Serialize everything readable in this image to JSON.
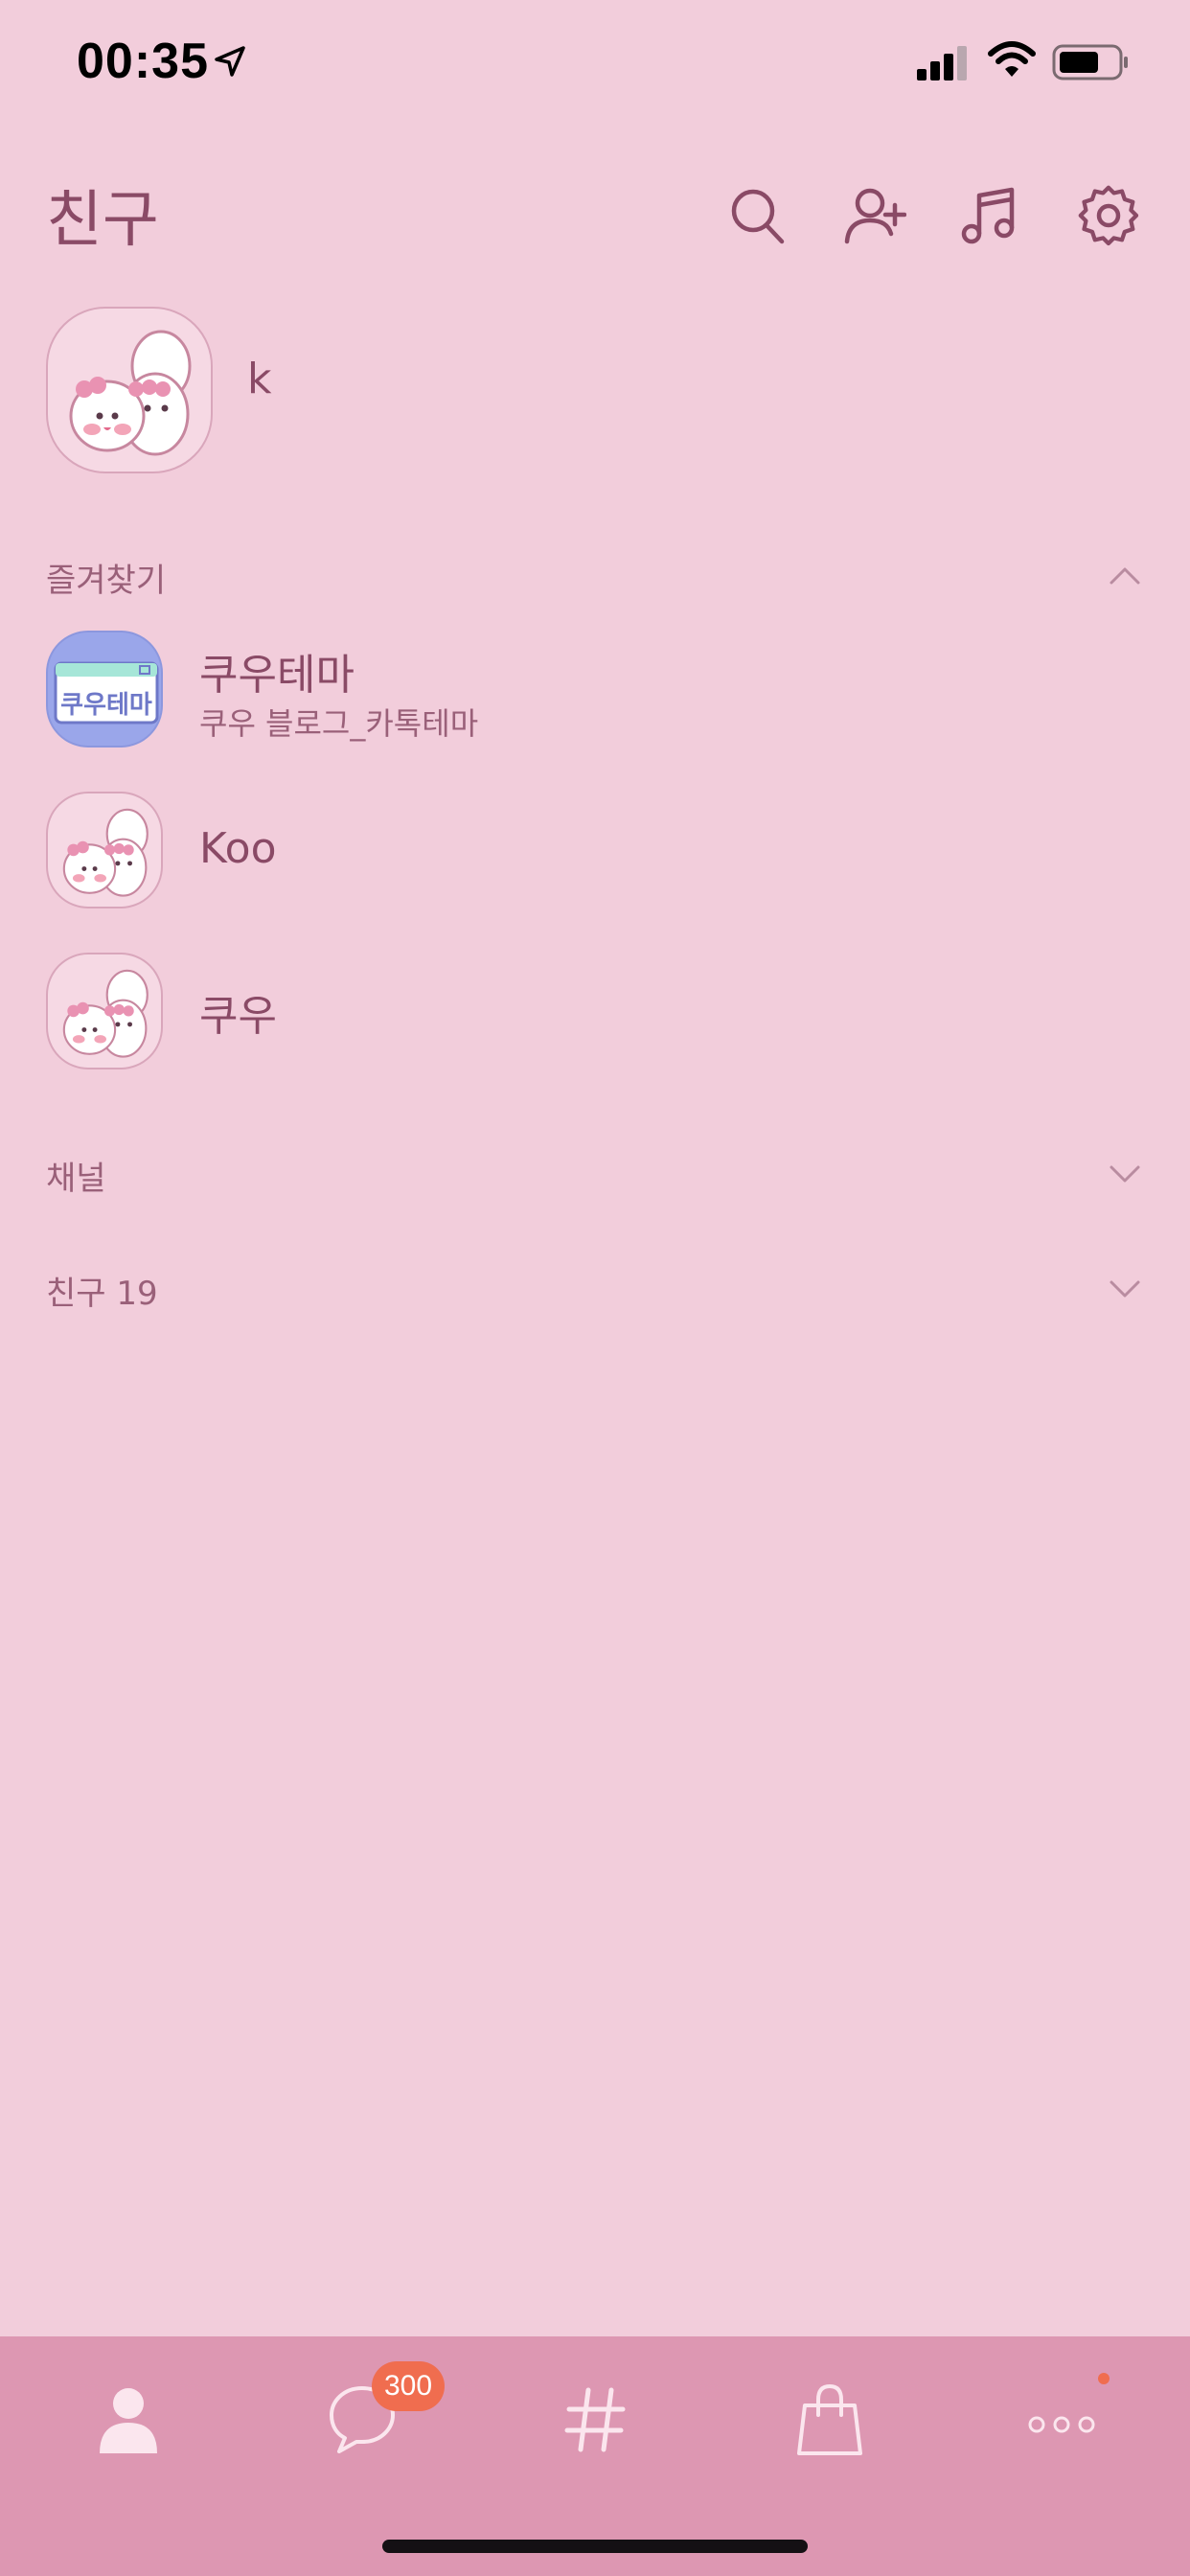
{
  "status_bar": {
    "time": "00:35",
    "icons": [
      "location-arrow-icon",
      "cellular-signal-icon",
      "wifi-icon",
      "battery-icon"
    ]
  },
  "header": {
    "title": "친구",
    "actions": [
      "search-icon",
      "add-friend-icon",
      "music-icon",
      "settings-icon"
    ]
  },
  "my_profile": {
    "name": "k"
  },
  "favorites": {
    "title": "즐겨찾기",
    "expanded": true,
    "items": [
      {
        "name": "쿠우테마",
        "status": "쿠우 블로그_카톡테마",
        "avatar_text": "쿠우테마"
      },
      {
        "name": "Koo",
        "status": ""
      },
      {
        "name": "쿠우",
        "status": ""
      }
    ]
  },
  "channels": {
    "title": "채널",
    "expanded": false
  },
  "friends": {
    "title": "친구 19",
    "expanded": false
  },
  "tab_bar": {
    "tabs": [
      "friends-tab",
      "chats-tab",
      "view-tab",
      "shopping-tab",
      "more-tab"
    ],
    "chat_badge": "300",
    "more_has_dot": true
  },
  "colors": {
    "background": "#f2cddb",
    "tab_bar": "#dd97b2",
    "text": "#8a4a66",
    "badge": "#f06d4f"
  }
}
